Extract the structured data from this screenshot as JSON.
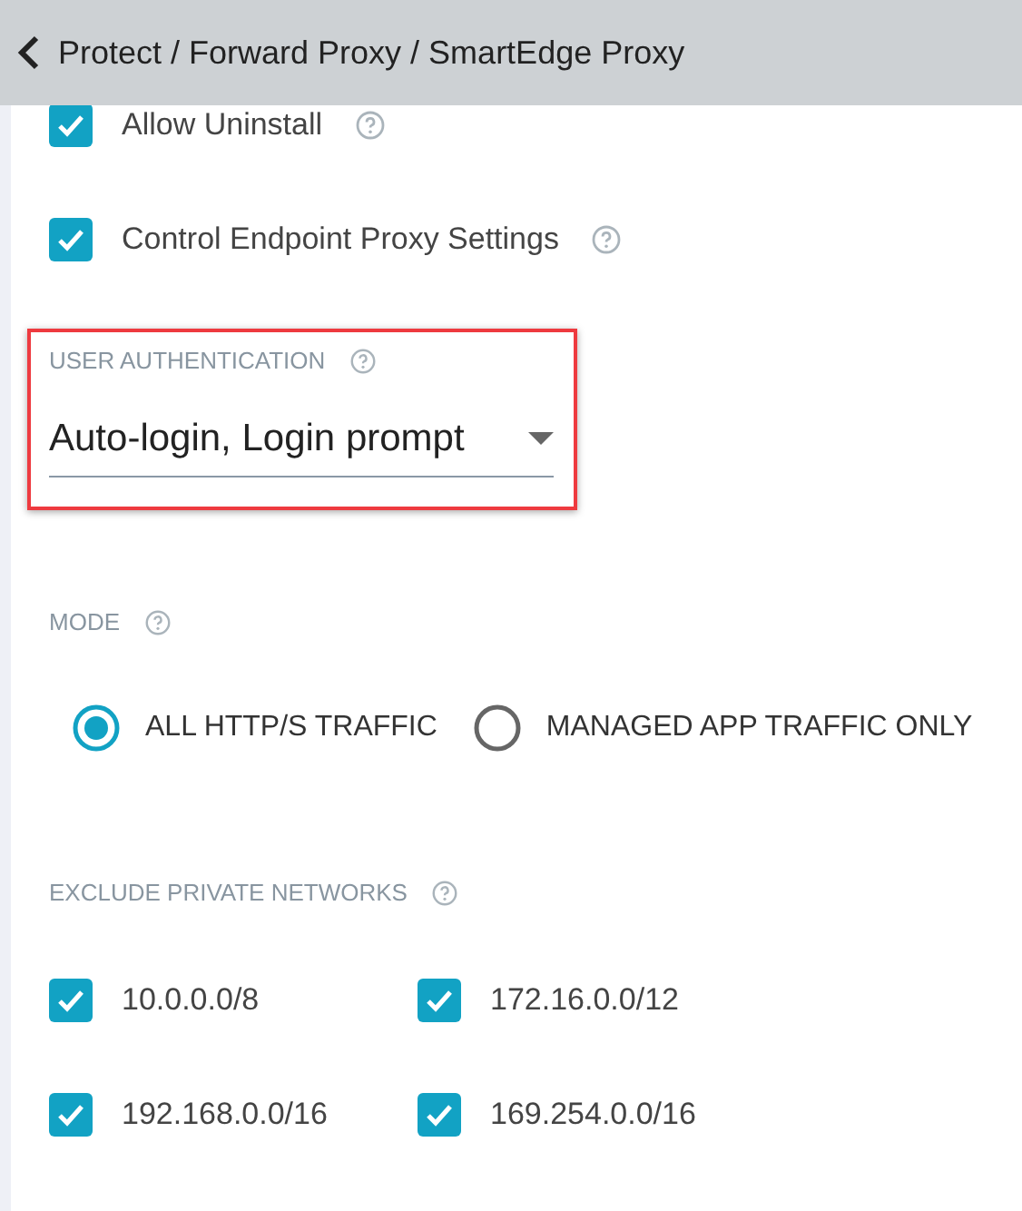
{
  "header": {
    "breadcrumb": "Protect / Forward Proxy / SmartEdge Proxy"
  },
  "options": [
    {
      "label": "Allow Uninstall",
      "checked": true
    },
    {
      "label": "Control Endpoint Proxy Settings",
      "checked": true
    }
  ],
  "user_authentication": {
    "label": "USER AUTHENTICATION",
    "value": "Auto-login, Login prompt",
    "highlighted": true
  },
  "mode": {
    "label": "MODE",
    "choices": [
      {
        "label": "ALL HTTP/S TRAFFIC",
        "selected": true
      },
      {
        "label": "MANAGED APP TRAFFIC ONLY",
        "selected": false
      }
    ]
  },
  "exclude_private_networks": {
    "label": "EXCLUDE PRIVATE NETWORKS",
    "networks": [
      {
        "label": "10.0.0.0/8",
        "checked": true
      },
      {
        "label": "172.16.0.0/12",
        "checked": true
      },
      {
        "label": "192.168.0.0/16",
        "checked": true
      },
      {
        "label": "169.254.0.0/16",
        "checked": true
      }
    ]
  }
}
